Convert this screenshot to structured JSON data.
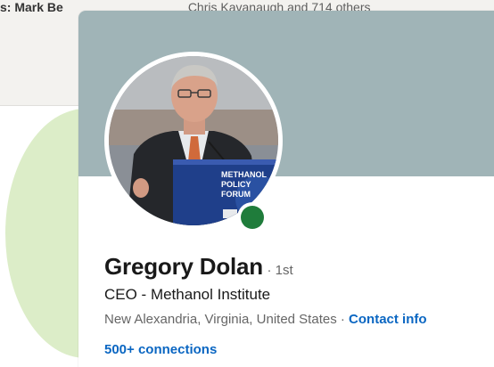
{
  "background": {
    "mutual_text_prefix": "s: Mark Be",
    "mutual_text_rest": "Chris Kavanaugh and 714 others",
    "accent_circle_color": "#dcedc8"
  },
  "profile": {
    "banner_color": "#a0b4b7",
    "photo_alt": "Gregory Dolan speaking at a podium",
    "podium_sign": [
      "METHANOL",
      "POLICY",
      "FORUM"
    ],
    "online_status_color": "#1f7c3b",
    "name": "Gregory Dolan",
    "degree": "· 1st",
    "headline": "CEO - Methanol Institute",
    "location": "New Alexandria, Virginia, United States ·",
    "contact_info_label": "Contact info",
    "connections_label": "500+ connections",
    "link_color": "#0a66c2"
  }
}
